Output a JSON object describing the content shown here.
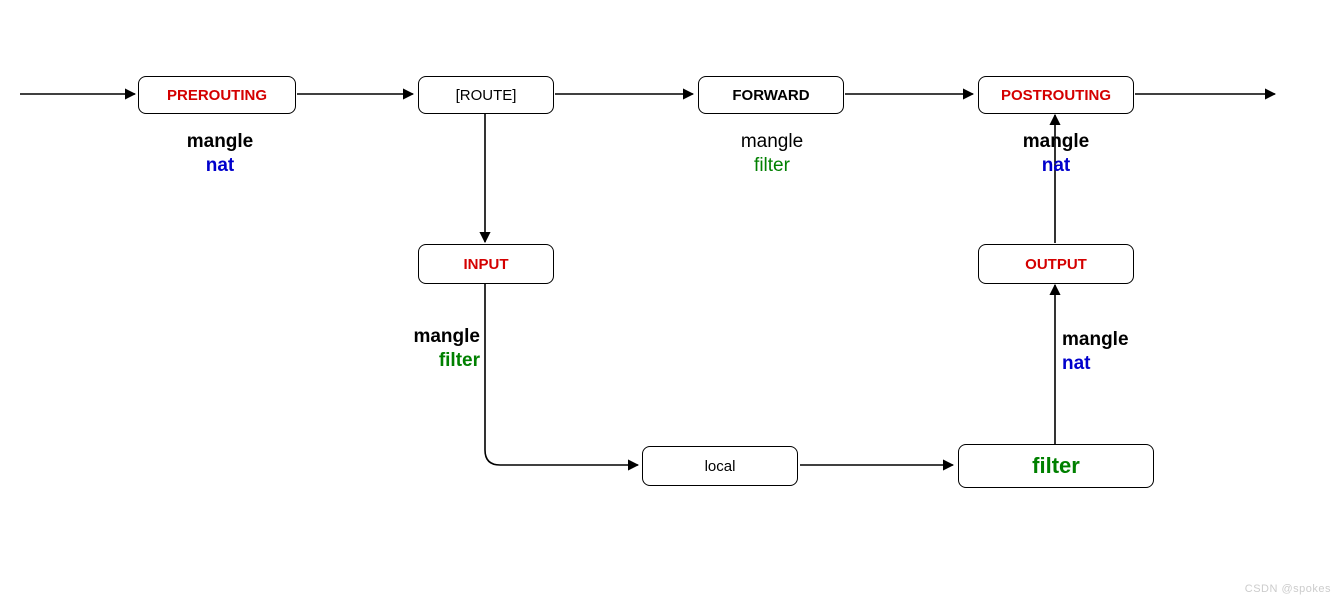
{
  "boxes": {
    "prerouting": {
      "label": "PREROUTING"
    },
    "route": {
      "label": "[ROUTE]"
    },
    "forward": {
      "label": "FORWARD"
    },
    "postrouting": {
      "label": "POSTROUTING"
    },
    "input": {
      "label": "INPUT"
    },
    "local": {
      "label": "local"
    },
    "filter": {
      "label": "filter"
    },
    "output": {
      "label": "OUTPUT"
    }
  },
  "annotations": {
    "prerouting": {
      "line1": "mangle",
      "line2": "nat"
    },
    "forward": {
      "line1": "mangle",
      "line2": "filter"
    },
    "postrouting": {
      "line1": "mangle",
      "line2": "nat"
    },
    "input": {
      "line1": "mangle",
      "line2": "filter"
    },
    "output": {
      "line1": "mangle",
      "line2": "nat"
    }
  },
  "watermark": "CSDN @spokes"
}
